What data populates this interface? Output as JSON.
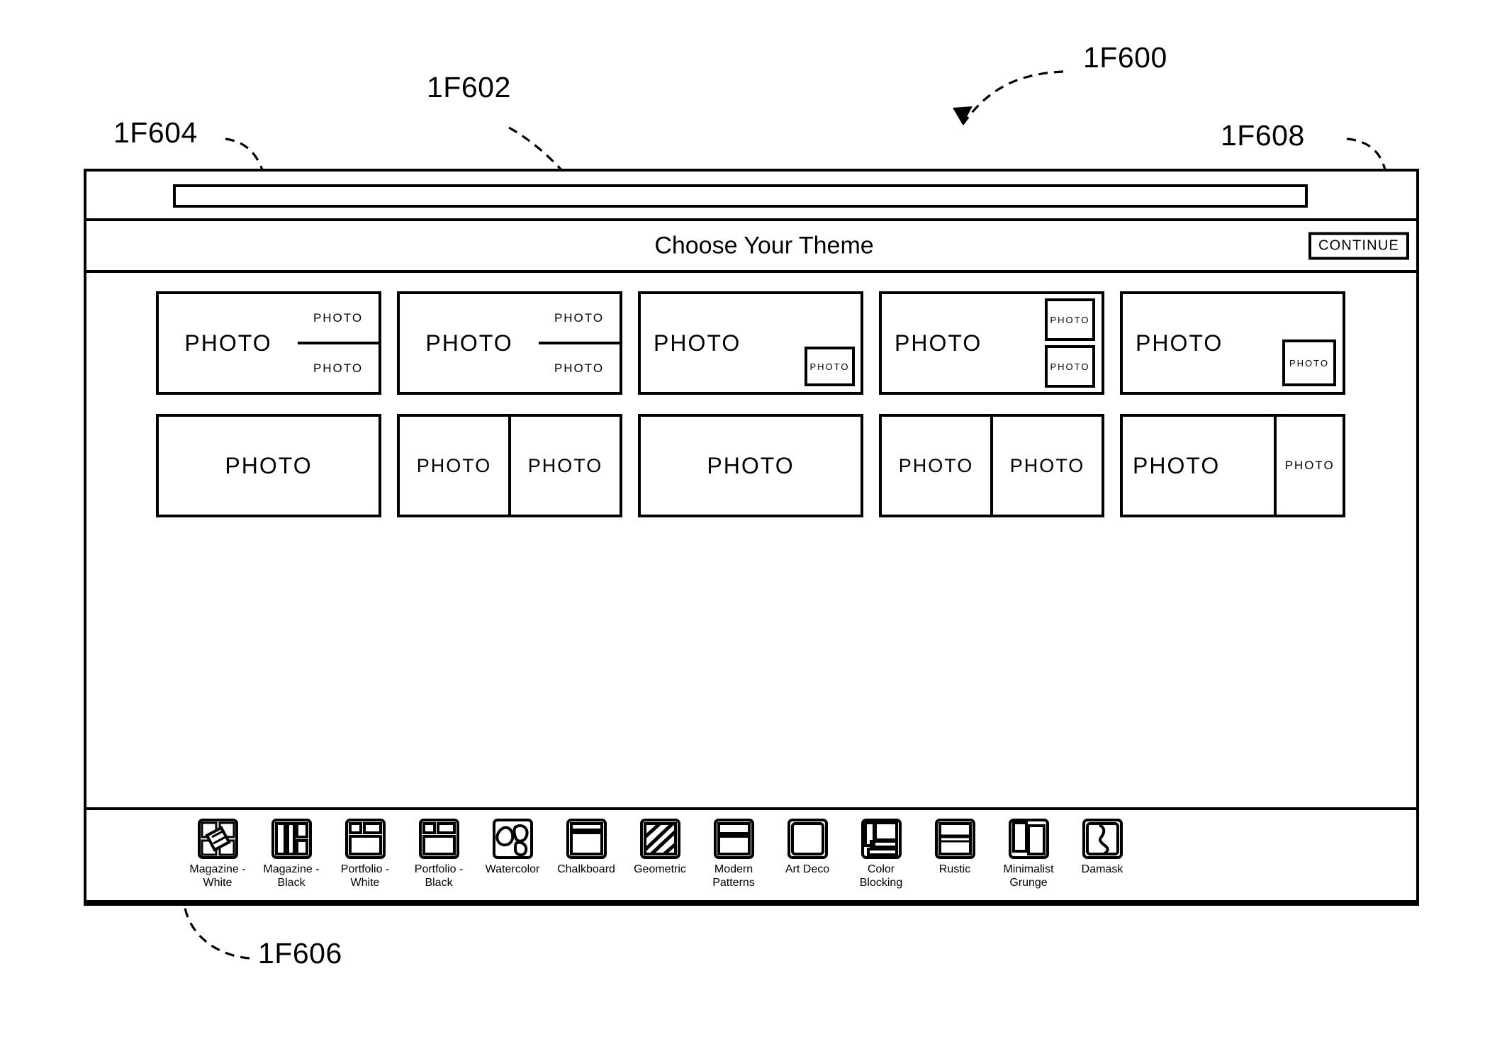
{
  "figure": {
    "callouts": [
      {
        "id": "fig-ref-1F600",
        "label": "1F600"
      },
      {
        "id": "fig-ref-1F602",
        "label": "1F602"
      },
      {
        "id": "fig-ref-1F604",
        "label": "1F604"
      },
      {
        "id": "fig-ref-1F606",
        "label": "1F606"
      },
      {
        "id": "fig-ref-1F608",
        "label": "1F608"
      }
    ]
  },
  "browser": {
    "address_bar_value": "",
    "address_bar_placeholder": ""
  },
  "header": {
    "title": "Choose Your Theme",
    "continue_label": "CONTINUE"
  },
  "layouts": {
    "photo_label": "PHOTO",
    "row1": [
      {
        "name": "one-big-left-two-stacked-right"
      },
      {
        "name": "one-big-left-two-stacked-right-alt"
      },
      {
        "name": "full-bleed-with-bottom-right-inset"
      },
      {
        "name": "full-bleed-with-two-right-insets"
      },
      {
        "name": "full-bleed-with-right-inset"
      }
    ],
    "row2": [
      {
        "name": "single-full"
      },
      {
        "name": "two-equal-columns"
      },
      {
        "name": "single-full-wide"
      },
      {
        "name": "two-equal-columns-alt"
      },
      {
        "name": "wide-left-narrow-right"
      }
    ]
  },
  "themes": {
    "selected_index": 0,
    "items": [
      {
        "label": "Magazine -\nWhite",
        "icon": "magazine-white-icon"
      },
      {
        "label": "Magazine -\nBlack",
        "icon": "magazine-black-icon"
      },
      {
        "label": "Portfolio -\nWhite",
        "icon": "portfolio-white-icon"
      },
      {
        "label": "Portfolio -\nBlack",
        "icon": "portfolio-black-icon"
      },
      {
        "label": "Watercolor",
        "icon": "watercolor-icon"
      },
      {
        "label": "Chalkboard",
        "icon": "chalkboard-icon"
      },
      {
        "label": "Geometric",
        "icon": "geometric-icon"
      },
      {
        "label": "Modern\nPatterns",
        "icon": "modern-patterns-icon"
      },
      {
        "label": "Art Deco",
        "icon": "art-deco-icon"
      },
      {
        "label": "Color\nBlocking",
        "icon": "color-blocking-icon"
      },
      {
        "label": "Rustic",
        "icon": "rustic-icon"
      },
      {
        "label": "Minimalist\nGrunge",
        "icon": "minimalist-grunge-icon"
      },
      {
        "label": "Damask",
        "icon": "damask-icon"
      }
    ]
  },
  "colors": {
    "ink": "#000000",
    "paper": "#ffffff"
  }
}
